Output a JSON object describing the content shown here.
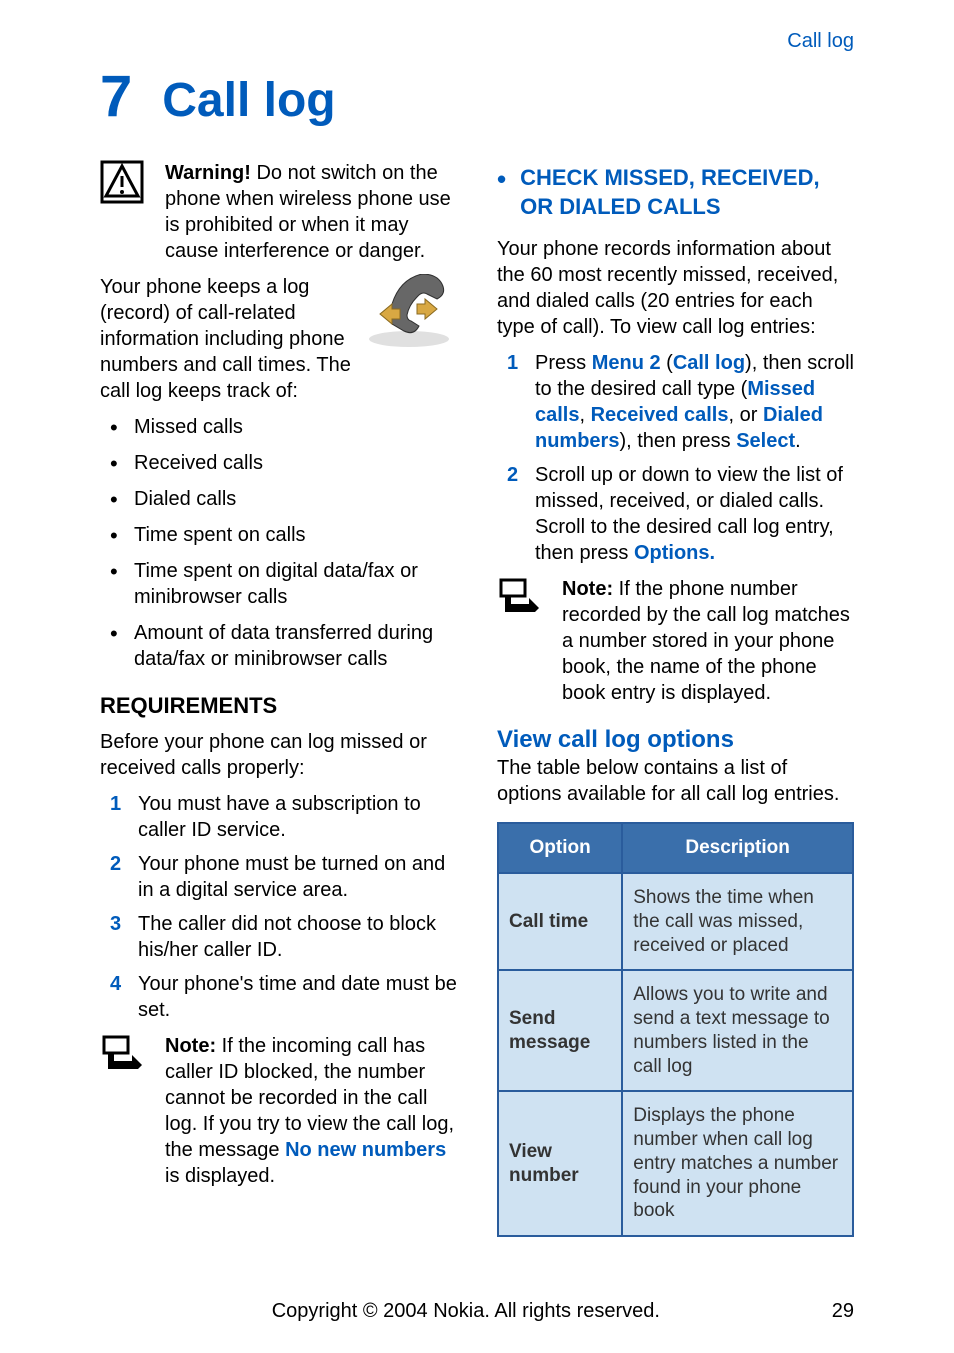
{
  "header": {
    "running_head": "Call log"
  },
  "chapter": {
    "number": "7",
    "title": "Call log"
  },
  "col1": {
    "warning_label": "Warning!",
    "warning_text": "Do not switch on the phone when wireless phone use is prohibited or when it may cause interference or danger.",
    "intro1": "Your phone keeps a log (record) of call-related information including phone numbers and call times. The call log keeps track of:",
    "bullets": [
      "Missed calls",
      "Received calls",
      "Dialed calls",
      "Time spent on calls",
      "Time spent on digital data/fax or minibrowser calls",
      "Amount of data transferred during data/fax or minibrowser calls"
    ],
    "requirements_heading": "REQUIREMENTS",
    "requirements_intro": "Before your phone can log missed or received calls properly:",
    "requirements": [
      "You must have a subscription to caller ID service.",
      "Your phone must be turned on and in a digital service area.",
      "The caller did not choose to block his/her caller ID.",
      "Your phone's time and date must be set."
    ],
    "note1_label": "Note:",
    "note1_text_a": "If the incoming call has caller ID blocked, the number cannot be recorded in the call log. If you try to view the call log, the message ",
    "note1_key": "No new numbers",
    "note1_text_b": " is displayed."
  },
  "col2": {
    "section_heading": "CHECK MISSED, RECEIVED, OR DIALED CALLS",
    "section_intro": "Your phone records information about the 60 most recently missed, received, and dialed calls (20 entries for each type of call). To view call log entries:",
    "step1_a": "Press ",
    "step1_k1": "Menu 2",
    "step1_b": " (",
    "step1_k2": "Call log",
    "step1_c": "), then scroll to the desired call type (",
    "step1_k3": "Missed calls",
    "step1_d": ", ",
    "step1_k4": "Received calls",
    "step1_e": ", or ",
    "step1_k5": "Dialed numbers",
    "step1_f": "), then press ",
    "step1_k6": "Select",
    "step1_g": ".",
    "step2_a": "Scroll up or down to view the list of missed, received, or dialed calls. Scroll to the desired call log entry, then press ",
    "step2_k1": "Options.",
    "note2_label": "Note:",
    "note2_text": "If the phone number recorded by the call log matches a number stored in your phone book, the name of the phone book entry is displayed.",
    "subsection_heading": "View call log options",
    "subsection_intro": "The table below contains a list of options available for all call log entries.",
    "table": {
      "headers": [
        "Option",
        "Description"
      ],
      "rows": [
        {
          "opt": "Call time",
          "opt_class": "green",
          "desc": "Shows the time when the call was missed, received or placed"
        },
        {
          "opt": "Send message",
          "opt_class": "",
          "desc": "Allows you to write and send a text message to numbers listed in the call log"
        },
        {
          "opt": "View number",
          "opt_class": "green",
          "desc": "Displays the phone number when call log entry matches a number found in your phone book"
        }
      ]
    }
  },
  "footer": {
    "copyright": "Copyright © 2004 Nokia. All rights reserved.",
    "page_number": "29"
  }
}
